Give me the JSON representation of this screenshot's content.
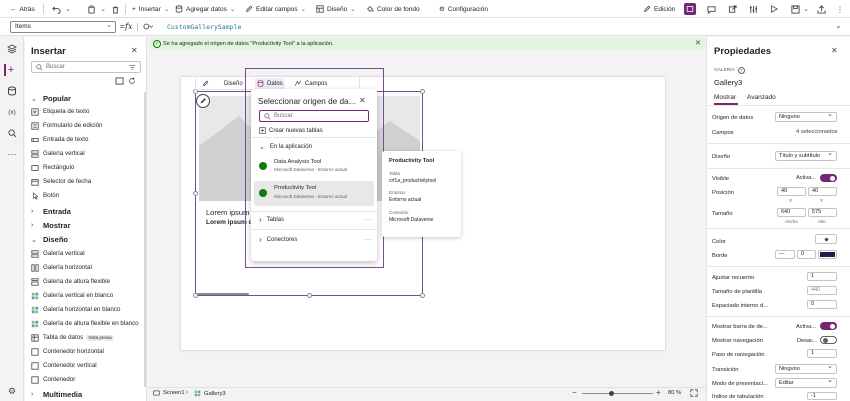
{
  "toolbar": {
    "back": "Atrás",
    "insert": "Insertar",
    "add_data": "Agregar datos",
    "edit_fields": "Editar campos",
    "design": "Diseño",
    "bg_color": "Color de fondo",
    "settings": "Configuración",
    "edit_mode": "Edición"
  },
  "formula": {
    "property": "Items",
    "fx": "fx",
    "equals": "=",
    "value": "CustomGallerySample"
  },
  "insert_pane": {
    "title": "Insertar",
    "search_placeholder": "Buscar",
    "groups": {
      "popular": "Popular",
      "input": "Entrada",
      "display": "Mostrar",
      "layout": "Diseño",
      "media": "Multimedia"
    },
    "popular_items": [
      "Etiqueta de texto",
      "Formulario de edición",
      "Entrada de texto",
      "Galería vertical",
      "Rectángulo",
      "Selector de fecha",
      "Botón"
    ],
    "layout_items": [
      "Galería vertical",
      "Galería horizontal",
      "Galería de altura flexible",
      "Galería vertical en blanco",
      "Galería horizontal en blanco",
      "Galería de altura flexible en blanco",
      "Tabla de datos",
      "Contenedor horizontal",
      "Contenedor vertical",
      "Contenedor"
    ],
    "preview_badge": "Vista previa"
  },
  "notification": "Se ha agregado el origen de datos \"Productivity Tool\" a la aplicación.",
  "gallery": {
    "item_title": "Lorem ipsum",
    "item_subtitle": "Lorem ipsum do"
  },
  "data_tabs": {
    "design": "Diseño",
    "data": "Datos",
    "fields": "Campos"
  },
  "datasource_popup": {
    "title": "Seleccionar origen de da...",
    "search_placeholder": "Buscar",
    "create_tables": "Crear nuevas tablas",
    "in_app": "En la aplicación",
    "sources": [
      {
        "name": "Data Analysis Tool",
        "env": "Microsoft Dataverse - Entorno actual"
      },
      {
        "name": "Productivity Tool",
        "env": "Microsoft Dataverse - Entorno actual"
      }
    ],
    "tables": "Tablas",
    "connectors": "Conectores",
    "more": "···"
  },
  "tooltip": {
    "title": "Productivity Tool",
    "table_label": "Tabla",
    "table_value": "crf1a_productivitytool",
    "env_label": "Entorno",
    "env_value": "Entorno actual",
    "conn_label": "Conexión",
    "conn_value": "Microsoft Dataverse"
  },
  "statusbar": {
    "screen": "Screen1",
    "gallery": "Gallery3",
    "zoom": "80 %",
    "minus": "−",
    "plus": "+"
  },
  "properties": {
    "title": "Propiedades",
    "type_label": "GALERÍA",
    "control_name": "Gallery3",
    "tabs": [
      "Mostrar",
      "Avanzado"
    ],
    "data_source_label": "Origen de datos",
    "data_source_value": "Ninguno",
    "fields_label": "Campos",
    "fields_value": "4 seleccionados",
    "layout_label": "Diseño",
    "layout_value": "Título y subtítulo",
    "visible_label": "Visible",
    "visible_value": "Activa...",
    "position_label": "Posición",
    "position_x": "40",
    "position_y": "40",
    "x_label": "X",
    "y_label": "Y",
    "size_label": "Tamaño",
    "width_value": "640",
    "height_value": "575",
    "width_label": "Ancho",
    "height_label": "Alto",
    "color_label": "Color",
    "border_label": "Borde",
    "border_style": "—",
    "border_width": "0",
    "border_color": "#1b1f4a",
    "wrap_label": "Ajustar recuento",
    "wrap_value": "1",
    "template_size_label": "Tamaño de plantilla",
    "template_size_value": "440",
    "padding_label": "Espaciado interno d...",
    "padding_value": "0",
    "scrollbar_label": "Mostrar barra de de...",
    "scrollbar_value": "Activa...",
    "nav_label": "Mostrar navegación",
    "nav_value": "Desac...",
    "nav_step_label": "Paso de navegación",
    "nav_step_value": "1",
    "transition_label": "Transición",
    "transition_value": "Ninguno",
    "presentation_label": "Modo de presentaci...",
    "presentation_value": "Editar",
    "tab_index_label": "Índice de tabulación",
    "tab_index_value": "-1"
  }
}
